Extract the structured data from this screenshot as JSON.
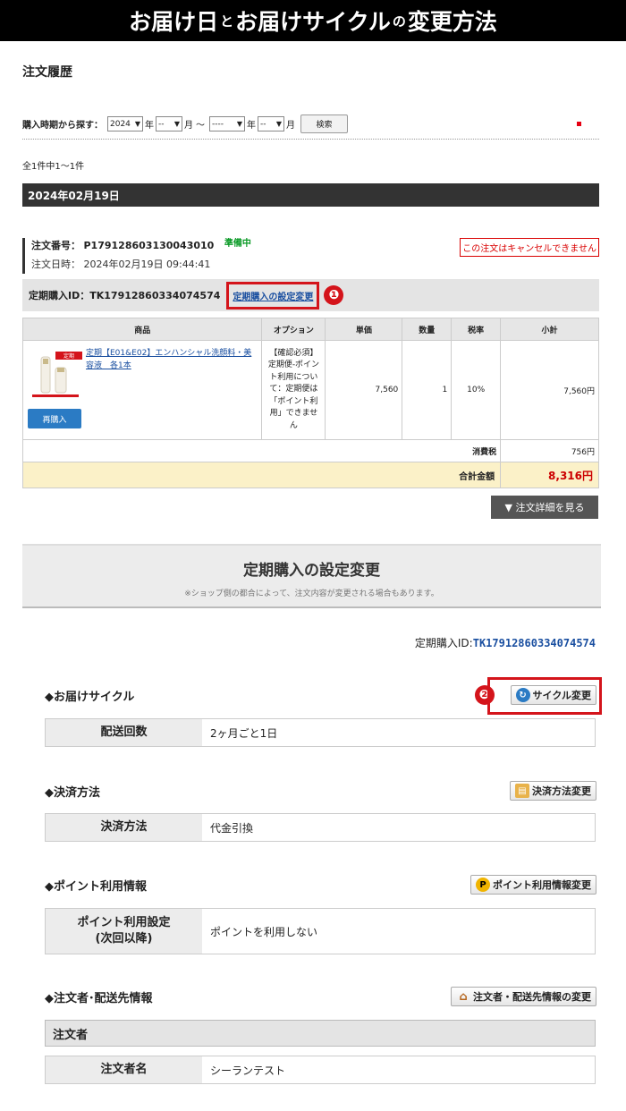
{
  "banner": {
    "part1": "お届け日",
    "and1": "と",
    "part2": "お届けサイクル",
    "and2": "の",
    "part3": "変更方法"
  },
  "page_title": "注文履歴",
  "filter": {
    "label": "購入時期から探す：",
    "from_year": "2024",
    "year_suffix": "年",
    "from_month": "--",
    "month_suffix": "月",
    "tilde": "〜",
    "to_year": "----",
    "to_month": "--",
    "search_label": "検索"
  },
  "count_text": "全1件中1〜1件",
  "date_bar": "2024年02月19日",
  "order": {
    "no_label": "注文番号：",
    "no": "P179128603130043010",
    "status": "準備中",
    "date_label": "注文日時：",
    "date": "2024年02月19日 09:44:41",
    "cancel_note": "この注文はキャンセルできません"
  },
  "teiki": {
    "id_label": "定期購入ID：",
    "id": "TK17912860334074574",
    "change_link": "定期購入の設定変更",
    "badge1": "❶",
    "badge2": "❷"
  },
  "table": {
    "headers": [
      "商品",
      "オプション",
      "単価",
      "数量",
      "税率",
      "小計"
    ],
    "item": {
      "name": "定期【E01&E02】エンハンシャル洗顔料・美容液　各1本",
      "img_tag": "定期",
      "rebuy": "再購入",
      "option": "【確認必須】定期便-ポイント利用について：定期便は「ポイント利用」できません",
      "unit_price": "7,560",
      "qty": "1",
      "tax_rate": "10%",
      "subtotal": "7,560円"
    },
    "tax_label": "消費税",
    "tax_value": "756円",
    "total_label": "合計金額",
    "total_value": "8,316円"
  },
  "detail_button": "▼ 注文詳細を見る",
  "section": {
    "title": "定期購入の設定変更",
    "sub": "※ショップ側の都合によって、注文内容が変更される場合もあります。",
    "id_label": "定期購入ID:",
    "id": "TK17912860334074574"
  },
  "cycle": {
    "heading": "◆お届けサイクル",
    "button": "サイクル変更",
    "key": "配送回数",
    "value": "2ヶ月ごと1日"
  },
  "payment": {
    "heading": "◆決済方法",
    "button": "決済方法変更",
    "key": "決済方法",
    "value": "代金引換"
  },
  "points": {
    "heading": "◆ポイント利用情報",
    "button": "ポイント利用情報変更",
    "key_line1": "ポイント利用設定",
    "key_line2": "(次回以降)",
    "value": "ポイントを利用しない",
    "icon": "P"
  },
  "customer": {
    "heading": "◆注文者･配送先情報",
    "button": "注文者・配送先情報の変更",
    "subhead": "注文者",
    "key": "注文者名",
    "value": "シーランテスト"
  },
  "colors": {
    "accent_red": "#d4141b",
    "link_blue": "#1a4fa0",
    "status_green": "#0a9a26"
  }
}
